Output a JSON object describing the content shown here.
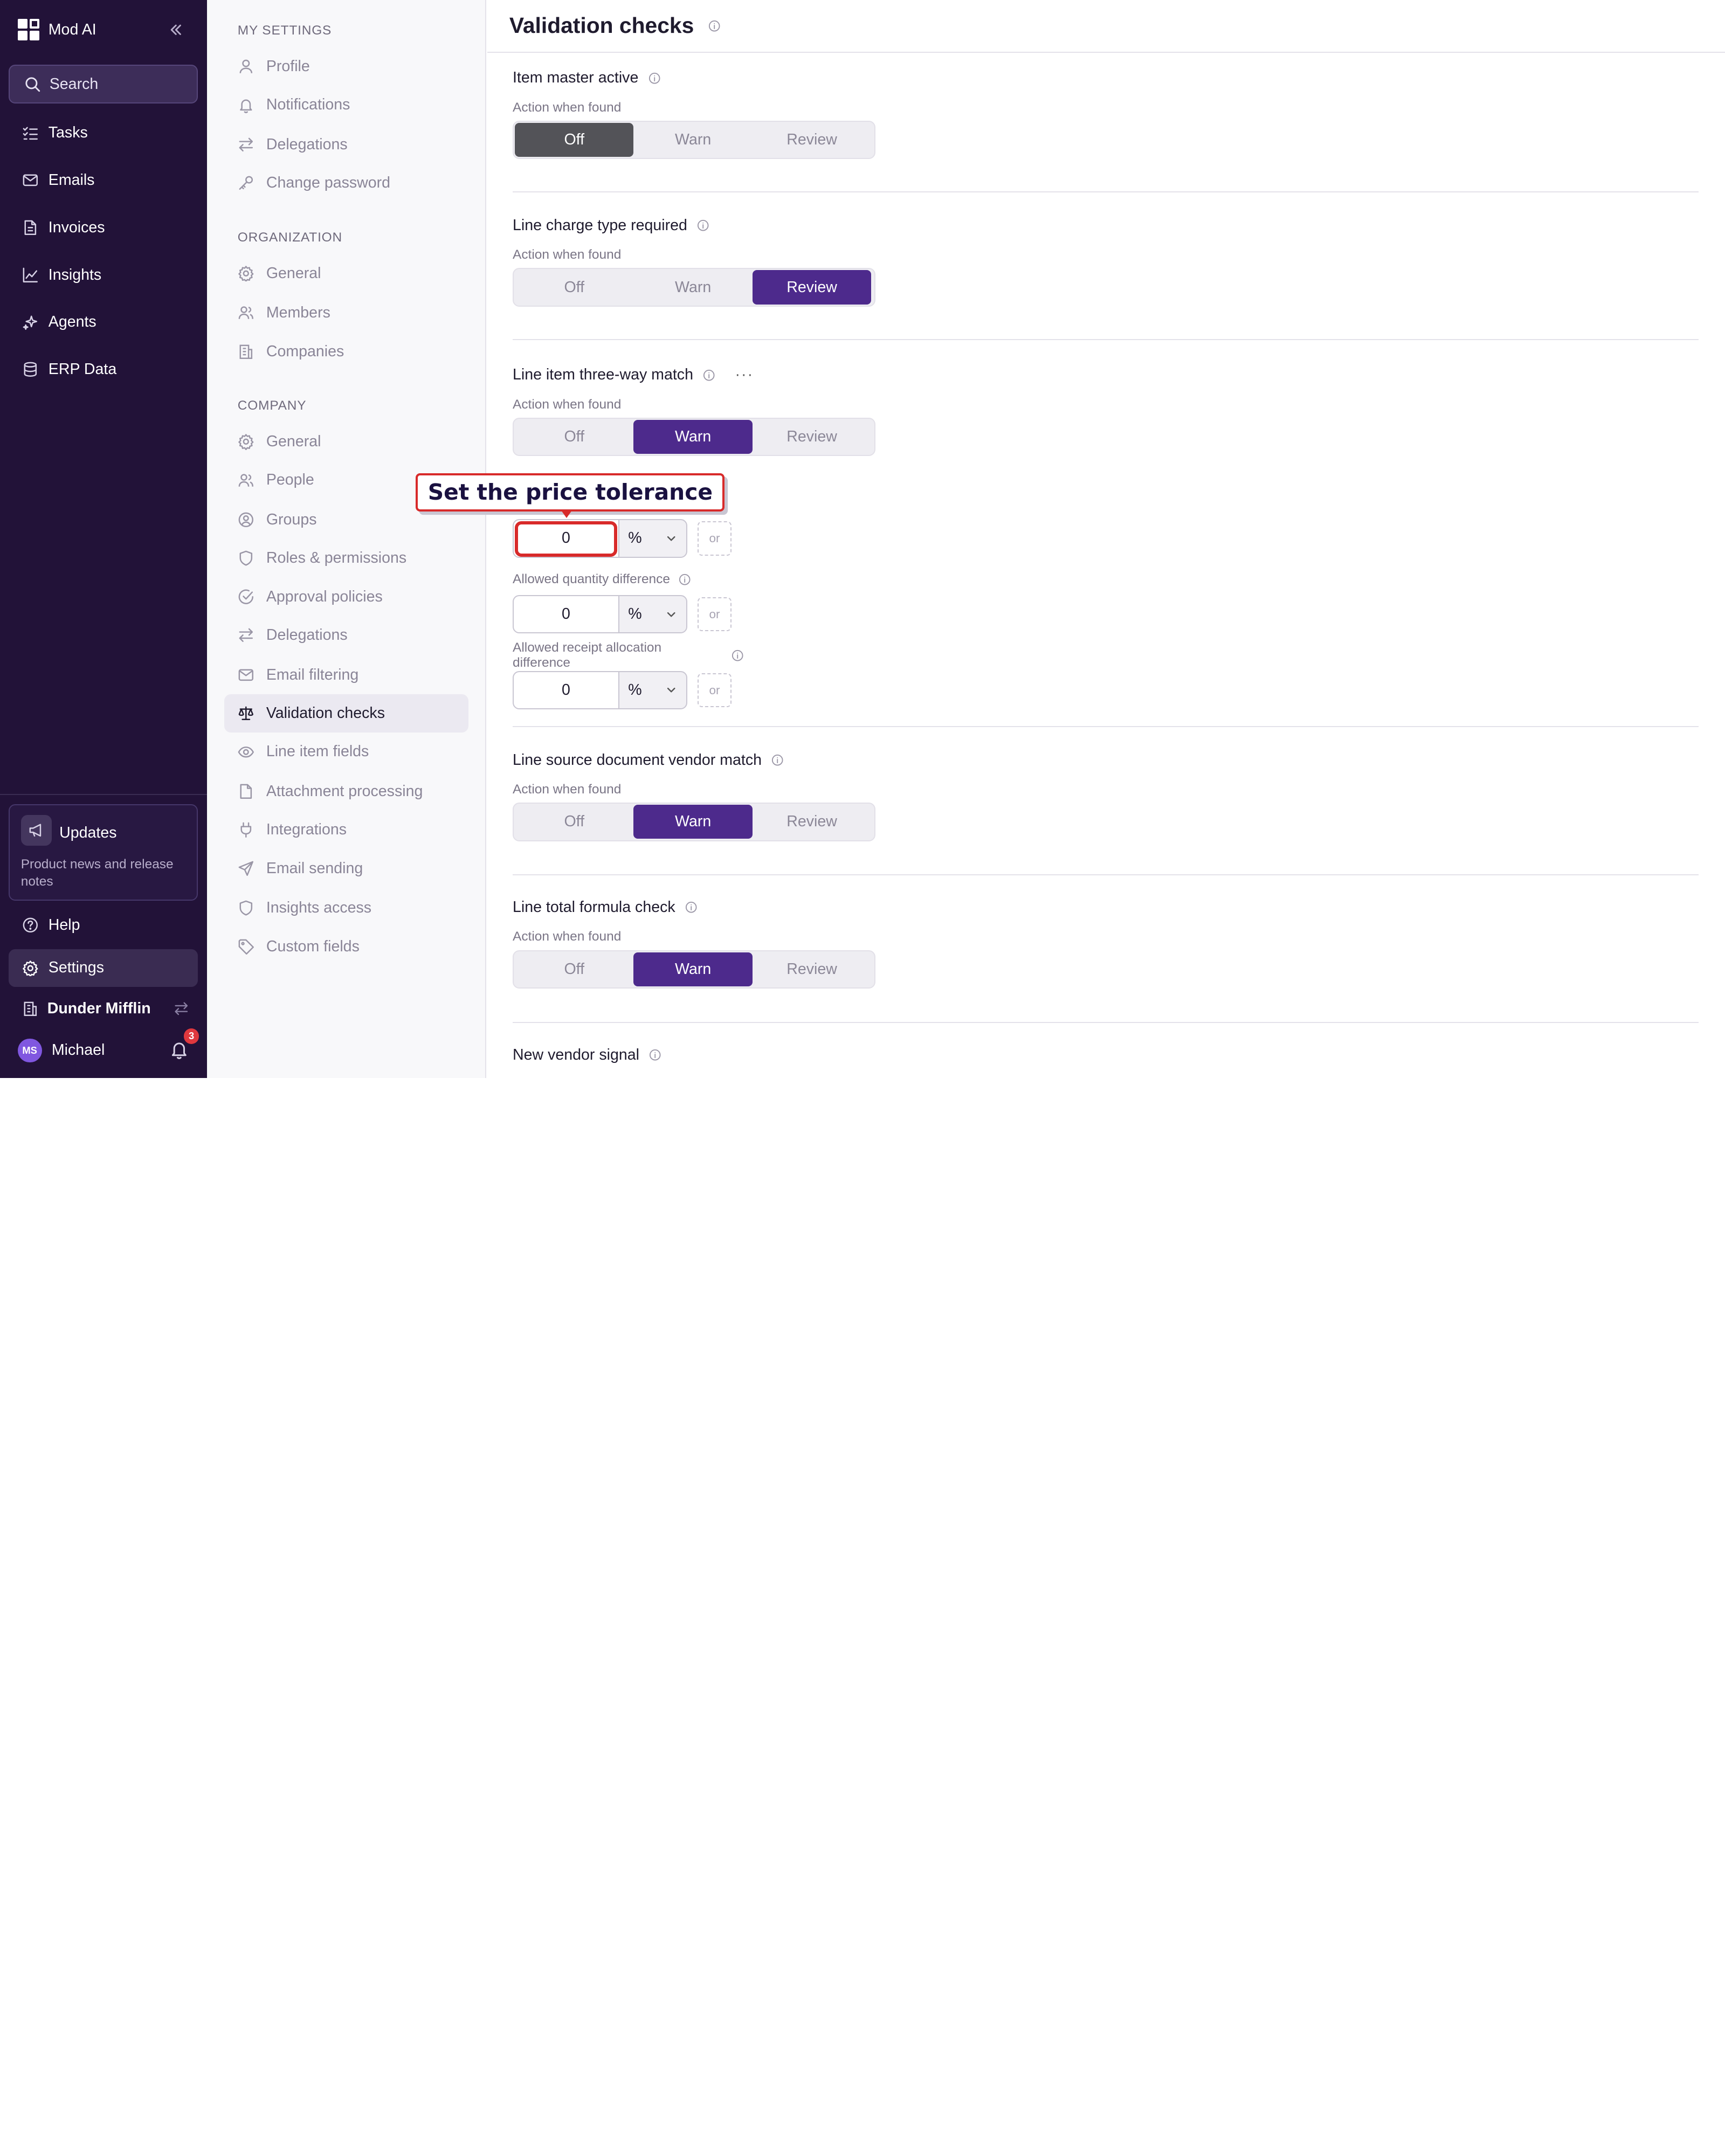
{
  "app": {
    "name": "Mod AI",
    "search_label": "Search"
  },
  "nav": {
    "items": [
      {
        "label": "Tasks",
        "icon": "tasks-icon"
      },
      {
        "label": "Emails",
        "icon": "mail-icon"
      },
      {
        "label": "Invoices",
        "icon": "file-icon"
      },
      {
        "label": "Insights",
        "icon": "chart-line-icon"
      },
      {
        "label": "Agents",
        "icon": "sparkles-icon"
      },
      {
        "label": "ERP Data",
        "icon": "database-icon"
      }
    ],
    "updates": {
      "title": "Updates",
      "description": "Product news and release notes"
    },
    "help_label": "Help",
    "settings_label": "Settings",
    "organization": "Dunder Mifflin",
    "user": {
      "initials": "MS",
      "name": "Michael",
      "notification_count": "3"
    }
  },
  "settings_menu": {
    "my_settings": {
      "title": "MY SETTINGS",
      "items": [
        "Profile",
        "Notifications",
        "Delegations",
        "Change password"
      ]
    },
    "organization": {
      "title": "ORGANIZATION",
      "items": [
        "General",
        "Members",
        "Companies"
      ]
    },
    "company": {
      "title": "COMPANY",
      "items": [
        "General",
        "People",
        "Groups",
        "Roles & permissions",
        "Approval policies",
        "Delegations",
        "Email filtering",
        "Validation checks",
        "Line item fields",
        "Attachment processing",
        "Integrations",
        "Email sending",
        "Insights access",
        "Custom fields"
      ],
      "active_item": "Validation checks"
    }
  },
  "page": {
    "title": "Validation checks",
    "action_label": "Action when found",
    "options": [
      "Off",
      "Warn",
      "Review"
    ],
    "checks": [
      {
        "title": "Item master active",
        "selected": "Off"
      },
      {
        "title": "Line charge type required",
        "selected": "Review"
      },
      {
        "title": "Line item three-way match",
        "selected": "Warn"
      },
      {
        "title": "Line source document vendor match",
        "selected": "Warn"
      },
      {
        "title": "Line total formula check",
        "selected": "Warn"
      },
      {
        "title": "New vendor signal"
      }
    ],
    "tolerances": [
      {
        "label": "",
        "value": "0",
        "unit": "%",
        "or_label": "or"
      },
      {
        "label": "Allowed quantity difference",
        "value": "0",
        "unit": "%",
        "or_label": "or"
      },
      {
        "label": "Allowed receipt allocation difference",
        "value": "0",
        "unit": "%",
        "or_label": "or"
      }
    ]
  },
  "annotation": {
    "callout_text": "Set the price tolerance",
    "highlight_color": "#d82a2a"
  },
  "colors": {
    "sidebar_bg": "#221238",
    "accent_purple": "#4d2a8c",
    "off_selected": "#535358"
  }
}
